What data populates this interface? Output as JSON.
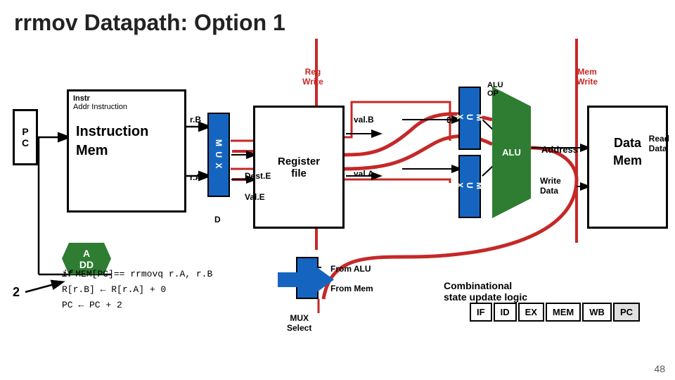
{
  "title": "rrmov Datapath: Option 1",
  "labels": {
    "pc": "P\nC",
    "pc_line1": "P",
    "pc_line2": "C",
    "instr_label_top": "Instr",
    "instr_label_sub": "Addr   Instruction",
    "instr_mem_main": "Instruction\nMem",
    "instr_mem_line1": "Instruction",
    "instr_mem_line2": "Mem",
    "add": "A\nDD",
    "add_line1": "A",
    "add_line2": "DD",
    "mux": "M\nU\nX",
    "reg_file_line1": "Register",
    "reg_file_line2": "file",
    "alu_line1": "ALU",
    "data_mem_line1": "Data",
    "data_mem_line2": "Mem",
    "reg_write": "Reg\nWrite",
    "reg_write_l1": "Reg",
    "reg_write_l2": "Write",
    "mem_write": "Mem\nWrite",
    "mem_write_l1": "Mem",
    "mem_write_l2": "Write",
    "alu_op": "ALU\nOP",
    "alu_op_l1": "ALU",
    "alu_op_l2": "OP",
    "address": "Address",
    "read_data": "Read\nData",
    "read_data_l1": "Read",
    "read_data_l2": "Data",
    "write_data": "Write\nData",
    "write_data_l1": "Write",
    "write_data_l2": "Data",
    "from_alu": "From ALU",
    "from_mem": "From Mem",
    "mux_select": "MUX\nSelect",
    "mux_select_l1": "MUX",
    "mux_select_l2": "Select",
    "rB": "r.B",
    "rA": "r.A",
    "valB": "val.B",
    "valA": "val.A",
    "destE": "Dest.E",
    "valE": "Val.E",
    "D": "D",
    "zero": "0",
    "code_line1": "if MEM[PC]==  rrmovq r.A, r.B",
    "code_if": "if",
    "code_mem": "MEM[PC]==",
    "code_inst": "rrmovq r.A, r.B",
    "code_line2": "R[r.B] ← R[r.A] + 0",
    "code_line3": "PC ← PC + 2",
    "combinatorial_line1": "Combinational",
    "combinatorial_line2": "state update logic",
    "stage_IF": "IF",
    "stage_ID": "ID",
    "stage_EX": "EX",
    "stage_MEM": "MEM",
    "stage_WB": "WB",
    "stage_PC": "PC",
    "page_num": "48",
    "two": "2"
  },
  "colors": {
    "red_accent": "#c62828",
    "blue_mux": "#1565c0",
    "green_block": "#2e7d32",
    "black": "#000000",
    "white": "#ffffff"
  }
}
